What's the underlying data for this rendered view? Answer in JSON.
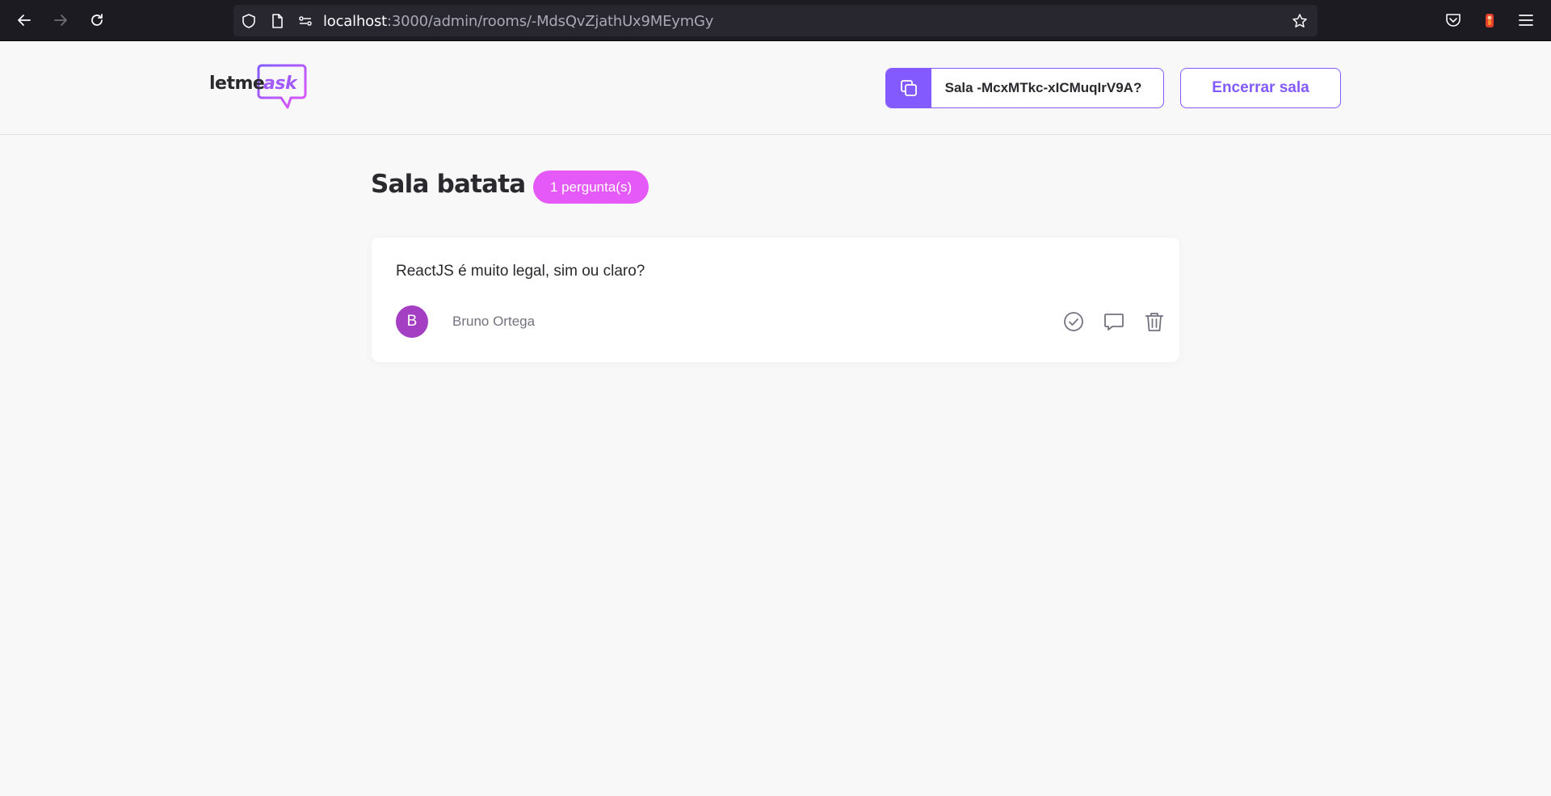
{
  "browser": {
    "url_host": "localhost",
    "url_path": ":3000/admin/rooms/-MdsQvZjathUx9MEymGy",
    "icons": [
      "back-icon",
      "forward-icon",
      "reload-icon",
      "shield-icon",
      "page-icon",
      "permissions-icon",
      "bookmark-star-icon",
      "pocket-icon",
      "extension-icon",
      "menu-icon"
    ]
  },
  "header": {
    "logo_main": "letme",
    "logo_accent": "ask",
    "room_code_label": "Sala -McxMTkc-xICMuqIrV9A?",
    "close_room_label": "Encerrar sala"
  },
  "room": {
    "title": "Sala batata",
    "question_count": "1 pergunta(s)"
  },
  "questions": [
    {
      "content": "ReactJS é muito legal, sim ou claro?",
      "author_initial": "B",
      "author_name": "Bruno Ortega",
      "actions": [
        "check-icon",
        "answer-icon",
        "delete-icon"
      ]
    }
  ],
  "colors": {
    "brand": "#835afd",
    "badge": "#e559f9",
    "avatar": "#a43fc4",
    "background": "#f8f8f8",
    "browser_bar": "#1c1b22"
  }
}
